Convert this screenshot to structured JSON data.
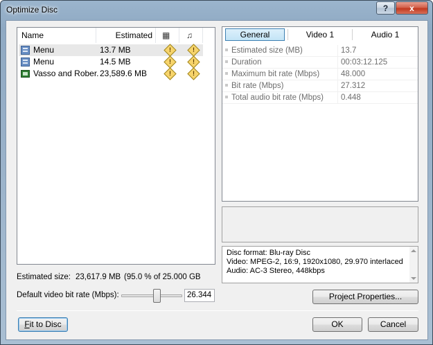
{
  "window": {
    "title": "Optimize Disc",
    "help_label": "?",
    "close_label": "x"
  },
  "list": {
    "columns": [
      "Name",
      "Estimated Size"
    ],
    "video_col_icon": "film-icon",
    "audio_col_icon": "music-note-icon",
    "rows": [
      {
        "icon": "menu-icon",
        "name": "Menu",
        "size": "13.7 MB",
        "video_warn": "!",
        "audio_warn": "!"
      },
      {
        "icon": "menu-icon",
        "name": "Menu",
        "size": "14.5 MB",
        "video_warn": "!",
        "audio_warn": "!"
      },
      {
        "icon": "film-icon",
        "name": "Vasso and Rober...",
        "size": "23,589.6 MB",
        "video_warn": "!",
        "audio_warn": "!"
      }
    ]
  },
  "tabs": [
    "General",
    "Video 1",
    "Audio 1"
  ],
  "properties": [
    {
      "label": "Estimated size (MB)",
      "value": "13.7"
    },
    {
      "label": "Duration",
      "value": "00:03:12.125"
    },
    {
      "label": "Maximum bit rate (Mbps)",
      "value": "48.000"
    },
    {
      "label": "Bit rate (Mbps)",
      "value": "27.312"
    },
    {
      "label": "Total audio bit rate (Mbps)",
      "value": "0.448"
    }
  ],
  "info": {
    "line1": "Disc format:  Blu-ray Disc",
    "line2": "Video:  MPEG-2, 16:9, 1920x1080, 29.970 interlaced",
    "line3": "Audio:  AC-3 Stereo, 448kbps"
  },
  "summary": {
    "estimated_label": "Estimated size:",
    "estimated_value": "23,617.9 MB",
    "estimated_pct": "(95.0 % of 25.000 GB"
  },
  "bitrate": {
    "label": "Default video bit rate (Mbps):",
    "value": "26.344",
    "slider_fraction": 0.6
  },
  "buttons": {
    "project_properties": "Project Properties...",
    "fit_to_disc_u": "F",
    "fit_to_disc_rest": "it to Disc",
    "ok": "OK",
    "cancel": "Cancel"
  }
}
